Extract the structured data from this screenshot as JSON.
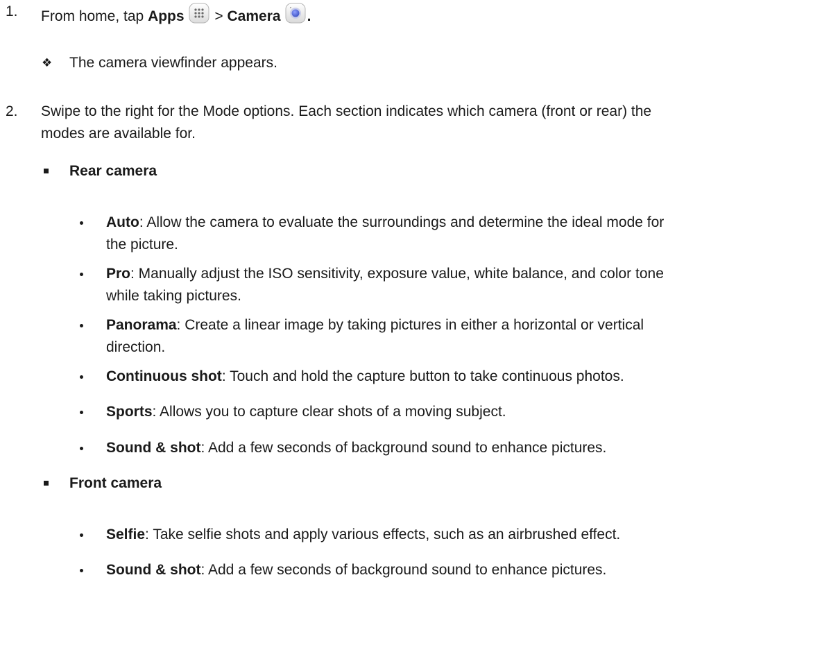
{
  "steps": [
    {
      "number": "1.",
      "text_before_apps": "From home, tap ",
      "apps_label": "Apps",
      "separator": " > ",
      "camera_label": "Camera",
      "end_punct": ".",
      "note_symbol": "❖",
      "note": "The camera viewfinder appears."
    },
    {
      "number": "2.",
      "line1": "Swipe to the right for the Mode options. Each section indicates which camera (front or rear) the",
      "line2": "modes are available for."
    }
  ],
  "sections": [
    {
      "title": "Rear camera",
      "items": [
        {
          "name": "Auto",
          "line1": ": Allow the camera to evaluate the surroundings and determine the ideal mode for",
          "line2": "the picture."
        },
        {
          "name": "Pro",
          "line1": ": Manually adjust the ISO sensitivity, exposure value, white balance, and color tone",
          "line2": "while taking pictures."
        },
        {
          "name": "Panorama",
          "line1": ": Create a linear image by taking pictures in either a horizontal or vertical",
          "line2": "direction."
        },
        {
          "name": "Continuous shot",
          "line1": ": Touch and hold the capture button to take continuous photos."
        },
        {
          "name": "Sports",
          "line1": ": Allows you to capture clear shots of a moving subject."
        },
        {
          "name": "Sound & shot",
          "line1": ": Add a few seconds of background sound to enhance pictures."
        }
      ]
    },
    {
      "title": "Front camera",
      "items": [
        {
          "name": "Selfie",
          "line1": ": Take selfie shots and apply various effects, such as an airbrushed effect."
        },
        {
          "name": "Sound & shot",
          "line1": ": Add a few seconds of background sound to enhance pictures."
        }
      ]
    }
  ],
  "icons": {
    "apps": "apps-grid-icon",
    "camera": "camera-app-icon"
  }
}
